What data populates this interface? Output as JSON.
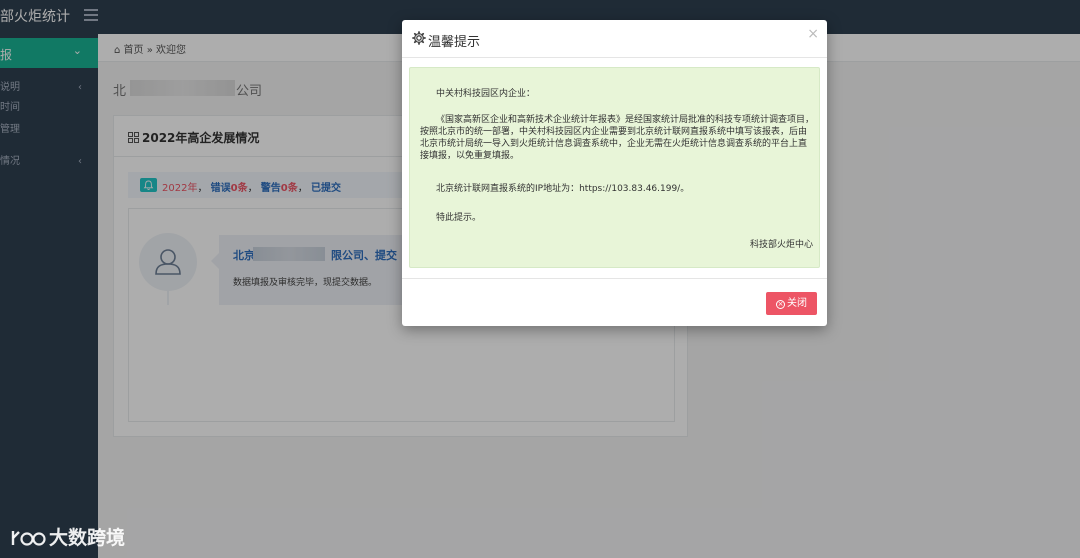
{
  "header": {
    "brand": "部火炬统计"
  },
  "sidebar": {
    "active_label": "报",
    "items": [
      {
        "label": "说明"
      },
      {
        "label": "时间"
      },
      {
        "label": "管理"
      },
      {
        "label": "情况"
      }
    ]
  },
  "breadcrumb": {
    "home": "首页",
    "separator": "»",
    "current": "欢迎您"
  },
  "content": {
    "company_prefix": "北",
    "company_suffix": "公司",
    "panel_title": "2022年高企发展情况",
    "status": {
      "year": "2022年",
      "sep": "，",
      "error_label": "错误",
      "error_count": "0条",
      "warn_label": "警告",
      "warn_count": "0条",
      "submitted": "已提交"
    },
    "timeline": {
      "title_prefix": "北京",
      "title_suffix": "限公司、提交",
      "body": "数据填报及审核完毕，现提交数据。"
    }
  },
  "modal": {
    "title": "温馨提示",
    "close_x": "×",
    "greeting": "中关村科技园区内企业：",
    "paragraph": "《国家高新区企业和高新技术企业统计年报表》是经国家统计局批准的科技专项统计调查项目，按照北京市的统一部署，中关村科技园区内企业需要到北京统计联网直报系统中填写该报表，后由北京市统计局统一导入到火炬统计信息调查系统中，企业无需在火炬统计信息调查系统的平台上直接填报，以免重复填报。",
    "ip_line": "北京统计联网直报系统的IP地址为：https://103.83.46.199/。",
    "closing": "特此提示。",
    "signature": "科技部火炬中心",
    "close_button": "关闭"
  },
  "watermark": {
    "text": "大数跨境"
  },
  "colors": {
    "sidebar": "#2f4050",
    "accent": "#1ab394",
    "danger": "#ed5565",
    "link": "#2f6fbf",
    "notice_bg": "#e8f5d8"
  }
}
